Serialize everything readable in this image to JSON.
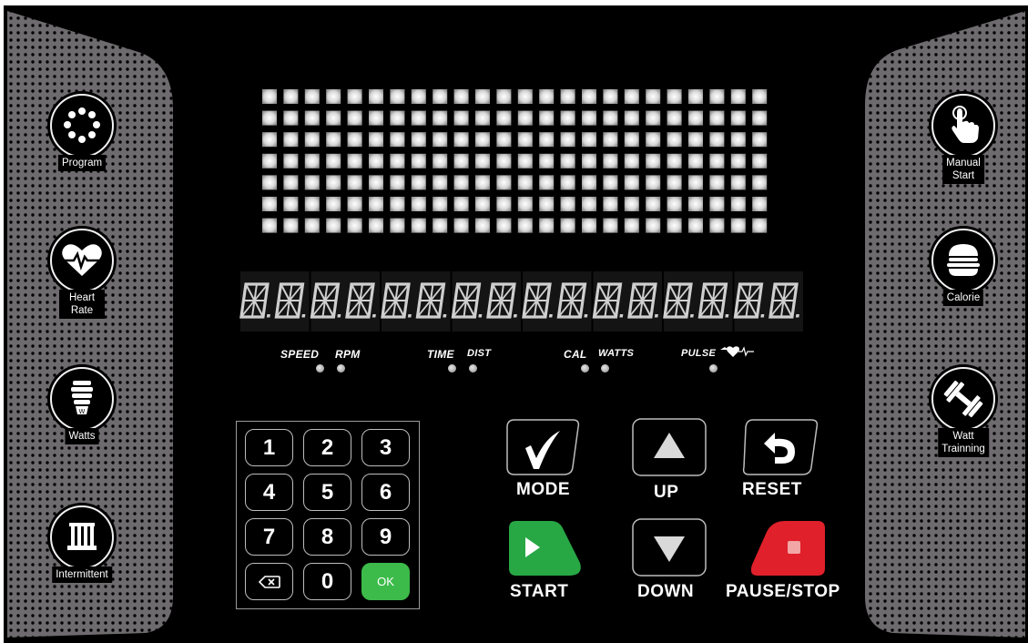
{
  "side_left": [
    {
      "label": "Program",
      "icon": "program-dots-icon"
    },
    {
      "label": "Heart Rate",
      "icon": "heart-pulse-icon"
    },
    {
      "label": "Watts",
      "icon": "bulb-icon"
    },
    {
      "label": "Intermittent",
      "icon": "bars-icon"
    }
  ],
  "side_right": [
    {
      "label": "Manual\nStart",
      "icon": "touch-hand-icon"
    },
    {
      "label": "Calorie",
      "icon": "burger-icon"
    },
    {
      "label": "Watt\nTrainning",
      "icon": "dumbbell-icon"
    }
  ],
  "indicators": {
    "speed": "SPEED",
    "rpm": "RPM",
    "time": "TIME",
    "dist": "DIST",
    "cal": "CAL",
    "watts": "WATTS",
    "pulse": "PULSE"
  },
  "keypad": {
    "keys": [
      "1",
      "2",
      "3",
      "4",
      "5",
      "6",
      "7",
      "8",
      "9",
      "",
      "0",
      "OK"
    ],
    "backspace_icon": "backspace-icon"
  },
  "controls": {
    "mode": "MODE",
    "up": "UP",
    "reset": "RESET",
    "start": "START",
    "down": "DOWN",
    "pause_stop": "PAUSE/STOP"
  },
  "colors": {
    "console_bg": "#000000",
    "side_panel": "#6e6b6e",
    "start": "#27a845",
    "ok": "#3dbb4a",
    "stop": "#e0202a",
    "matrix_led": "#e6e6e6"
  },
  "display": {
    "matrix_rows": 7,
    "matrix_cols": 24,
    "segment_digits": 16
  }
}
